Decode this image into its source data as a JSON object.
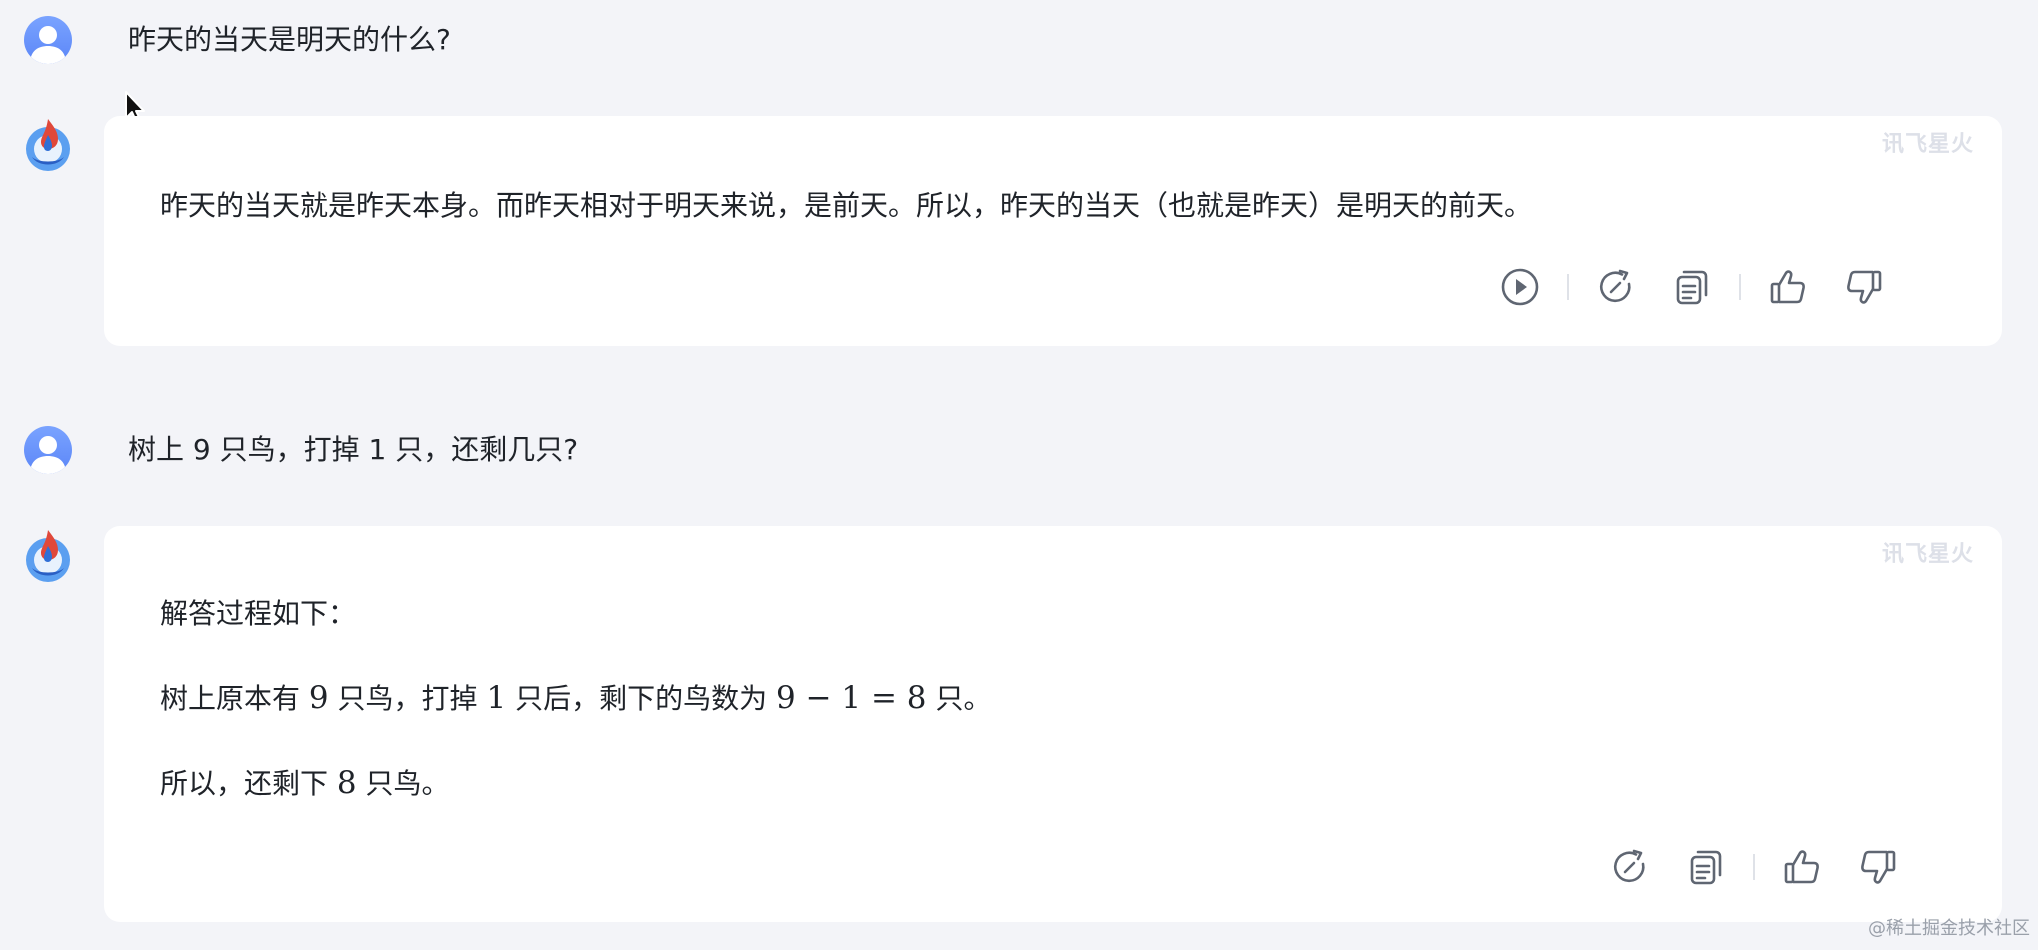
{
  "conversation": [
    {
      "question": "昨天的当天是明天的什么?",
      "answer": {
        "brand": "讯飞星火",
        "text": "昨天的当天就是昨天本身。而昨天相对于明天来说，是前天。所以，昨天的当天（也就是昨天）是明天的前天。",
        "actions": [
          "play-icon",
          "regenerate-icon",
          "copy-icon",
          "thumbs-up-icon",
          "thumbs-down-icon"
        ]
      }
    },
    {
      "question": "树上 9 只鸟，打掉 1 只，还剩几只?",
      "answer": {
        "brand": "讯飞星火",
        "line1": "解答过程如下：",
        "line2_prefix": "树上原本有 ",
        "line2_n1": "9",
        "line2_mid1": " 只鸟，打掉 ",
        "line2_n2": "1",
        "line2_mid2": " 只后，剩下的鸟数为 ",
        "line2_formula": "9 − 1 = 8",
        "line2_suffix": " 只。",
        "line3_prefix": "所以，还剩下 ",
        "line3_n": "8",
        "line3_suffix": " 只鸟。",
        "actions": [
          "regenerate-icon",
          "copy-icon",
          "thumbs-up-icon",
          "thumbs-down-icon"
        ]
      }
    }
  ],
  "footer": {
    "credit": "@稀土掘金技术社区"
  },
  "colors": {
    "background": "#f3f4f8",
    "bubble": "#ffffff",
    "user_avatar": "#6b95fb",
    "icon": "#5f6672"
  }
}
